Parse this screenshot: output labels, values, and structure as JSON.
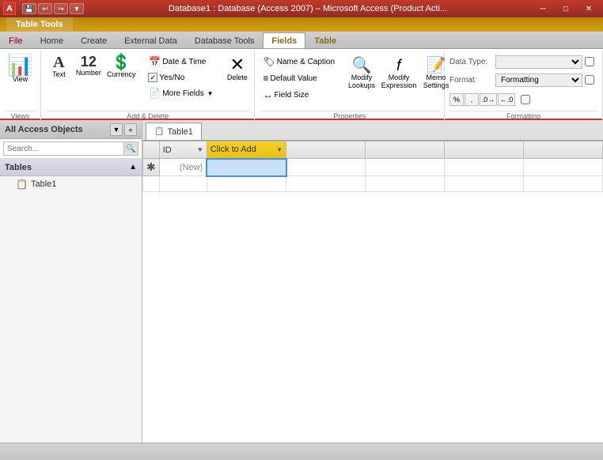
{
  "titlebar": {
    "logo": "A",
    "app_name": "Database1 : Database (Access 2007) – Microsoft Access (Product Acti...",
    "quick_save": "💾",
    "undo": "↩",
    "redo": "↪",
    "minimize": "─",
    "restore": "□",
    "close": "✕"
  },
  "table_tools": {
    "label": "Table Tools"
  },
  "ribbon_tabs": [
    {
      "id": "file",
      "label": "File",
      "active": false
    },
    {
      "id": "home",
      "label": "Home",
      "active": false
    },
    {
      "id": "create",
      "label": "Create",
      "active": false
    },
    {
      "id": "external_data",
      "label": "External Data",
      "active": false
    },
    {
      "id": "database_tools",
      "label": "Database Tools",
      "active": false
    },
    {
      "id": "fields",
      "label": "Fields",
      "active": true
    },
    {
      "id": "table",
      "label": "Table",
      "active": false
    }
  ],
  "ribbon": {
    "views": {
      "group_label": "Views",
      "view_btn": "View",
      "view_icon": "📊"
    },
    "add_delete": {
      "group_label": "Add & Delete",
      "text_btn": "Text",
      "text_icon": "A",
      "number_btn": "Number",
      "number_icon": "12",
      "currency_btn": "Currency",
      "currency_icon": "$",
      "datetime_btn": "Date & Time",
      "datetime_icon": "📅",
      "yesno_btn": "Yes/No",
      "yesno_checked": true,
      "more_fields_btn": "More Fields",
      "delete_btn": "Delete"
    },
    "properties": {
      "group_label": "Properties",
      "name_caption_btn": "Name & Caption",
      "default_value_btn": "Default Value",
      "field_size_btn": "Field Size",
      "modify_lookups_btn": "Modify\nLookups",
      "modify_expression_btn": "Modify\nExpression",
      "memo_settings_btn": "Memo\nSettings"
    },
    "formatting": {
      "group_label": "Formatting",
      "data_type_label": "Data Type:",
      "data_type_value": "",
      "format_label": "Format:",
      "format_value": "Formatting",
      "percent_btn": "%",
      "comma_btn": ",",
      "increase_dec_btn": ".0→",
      "decrease_dec_btn": "←.0"
    }
  },
  "nav_panel": {
    "title": "All Access Objects",
    "collapse_btn": "«",
    "dropdown_btn": "▼",
    "search_placeholder": "Search...",
    "tables_section": "Tables",
    "tables_toggle": "▲",
    "items": [
      {
        "label": "Table1",
        "icon": "📋"
      }
    ]
  },
  "document_tab": {
    "icon": "📋",
    "label": "Table1"
  },
  "table": {
    "columns": [
      {
        "id": "row_selector",
        "label": ""
      },
      {
        "id": "id",
        "label": "ID",
        "has_dropdown": true
      },
      {
        "id": "click_to_add",
        "label": "Click to Add",
        "has_dropdown": true
      }
    ],
    "rows": [
      {
        "selector": "✱",
        "id": "(New)",
        "value": ""
      }
    ]
  },
  "status_bar": {
    "text": ""
  }
}
